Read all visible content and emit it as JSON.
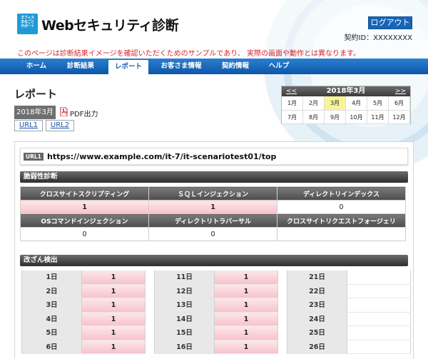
{
  "header": {
    "logo_lines": [
      "オフィス",
      "まるごと",
      "サポート"
    ],
    "title": "Webセキュリティ診断",
    "logout_label": "ログアウト",
    "contract_id": "契約ID：XXXXXXXX",
    "notice": "このページは診断結果イメージを確認いただくためのサンプルであり、 実際の画面や動作とは異なります。"
  },
  "nav": [
    "ホーム",
    "診断結果",
    "レポート",
    "お客さま情報",
    "契約情報",
    "ヘルプ"
  ],
  "nav_active": "レポート",
  "page": {
    "title": "レポート",
    "month_badge": "2018年3月",
    "pdf_label": "PDF出力",
    "url_tabs": [
      "URL1",
      "URL2"
    ]
  },
  "calendar": {
    "prev": "<<",
    "next": ">>",
    "title": "2018年3月",
    "months": [
      "1月",
      "2月",
      "3月",
      "4月",
      "5月",
      "6月",
      "7月",
      "8月",
      "9月",
      "10月",
      "11月",
      "12月"
    ],
    "selected": "3月"
  },
  "report": {
    "url_tag": "URL1",
    "url": "https://www.example.com/it-7/it-scenariotest01/top",
    "vuln_section": "脆弱性診断",
    "vuln_headers_1": [
      "クロスサイトスクリプティング",
      "ＳＱＬインジェクション",
      "ディレクトリインデックス"
    ],
    "vuln_values_1": [
      "1",
      "1",
      "0"
    ],
    "vuln_headers_2": [
      "OSコマンドインジェクション",
      "ディレクトリトラバーサル",
      "クロスサイトリクエストフォージェリ"
    ],
    "vuln_values_2": [
      "0",
      "0",
      ""
    ],
    "tamper_section": "改ざん検出",
    "days": [
      [
        {
          "day": "1日",
          "v": "1"
        },
        {
          "day": "2日",
          "v": "1"
        },
        {
          "day": "3日",
          "v": "1"
        },
        {
          "day": "4日",
          "v": "1"
        },
        {
          "day": "5日",
          "v": "1"
        },
        {
          "day": "6日",
          "v": "1"
        }
      ],
      [
        {
          "day": "11日",
          "v": "1"
        },
        {
          "day": "12日",
          "v": "1"
        },
        {
          "day": "13日",
          "v": "1"
        },
        {
          "day": "14日",
          "v": "1"
        },
        {
          "day": "15日",
          "v": "1"
        },
        {
          "day": "16日",
          "v": "1"
        }
      ],
      [
        {
          "day": "21日",
          "v": ""
        },
        {
          "day": "22日",
          "v": ""
        },
        {
          "day": "23日",
          "v": ""
        },
        {
          "day": "24日",
          "v": ""
        },
        {
          "day": "25日",
          "v": ""
        },
        {
          "day": "26日",
          "v": ""
        }
      ]
    ]
  },
  "colors": {
    "brand_blue": "#1666b8",
    "notice_red": "#d9232b",
    "alert_pink": "#f7c3c9",
    "calendar_selected": "#f8f49a"
  }
}
